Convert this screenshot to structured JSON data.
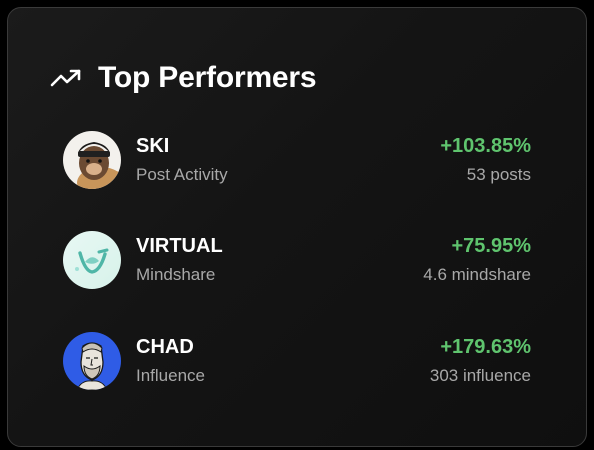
{
  "card": {
    "title": "Top Performers",
    "title_icon": "trending-up-icon"
  },
  "performers": [
    {
      "name": "SKI",
      "metric": "Post Activity",
      "change": "+103.85%",
      "count": "53 posts",
      "avatar": "ski-avatar"
    },
    {
      "name": "VIRTUAL",
      "metric": "Mindshare",
      "change": "+75.95%",
      "count": "4.6 mindshare",
      "avatar": "virtual-avatar"
    },
    {
      "name": "CHAD",
      "metric": "Influence",
      "change": "+179.63%",
      "count": "303 influence",
      "avatar": "chad-avatar"
    }
  ],
  "colors": {
    "positive": "#5fc46e",
    "muted": "#a8a8a8",
    "border": "#3a3a3a"
  }
}
